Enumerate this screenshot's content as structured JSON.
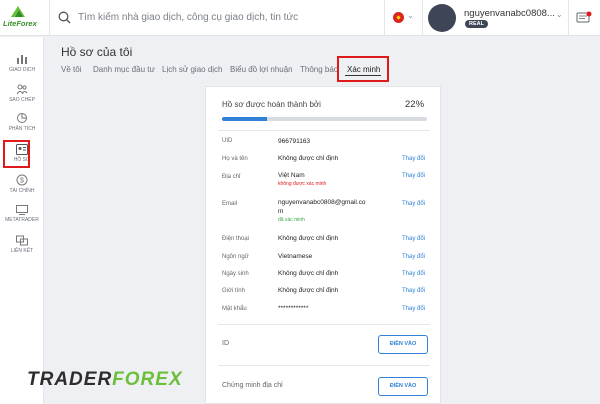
{
  "brand": {
    "logo_text": "LiteForex"
  },
  "search": {
    "placeholder": "Tìm kiếm nhà giao dịch, công cụ giao dịch, tin tức"
  },
  "user": {
    "name": "nguyenvanabc0808...",
    "badge": "REAL"
  },
  "sidebar": {
    "items": [
      {
        "label": "GIAO DỊCH",
        "icon": "trading-icon"
      },
      {
        "label": "SAO CHÉP",
        "icon": "copy-icon"
      },
      {
        "label": "PHÂN TÍCH",
        "icon": "analytics-icon"
      },
      {
        "label": "HỒ SƠ",
        "icon": "profile-icon"
      },
      {
        "label": "TÀI CHÍNH",
        "icon": "dollar-icon"
      },
      {
        "label": "METATRADER",
        "icon": "metatrader-icon"
      },
      {
        "label": "LIÊN KẾT",
        "icon": "link-icon"
      }
    ]
  },
  "page": {
    "title": "Hồ sơ của tôi"
  },
  "tabs": [
    "Về tôi",
    "Danh mục đầu tư",
    "Lịch sử giao dịch",
    "Biểu đồ lợi nhuận",
    "Thông báo",
    "Xác minh"
  ],
  "profile": {
    "completion_label": "Hồ sơ được hoàn thành bởi",
    "completion_percent": "22%",
    "completion_fraction": 0.22,
    "rows": [
      {
        "label": "UID",
        "value": "966791163"
      },
      {
        "label": "Họ và tên",
        "value": "Không được chỉ định",
        "action": "Thay đổi"
      },
      {
        "label": "Địa chỉ",
        "value": "Việt Nam",
        "sub": "không được xác minh",
        "action": "Thay đổi"
      },
      {
        "label": "Email",
        "value": "nguyenvanabc0808@gmail.co",
        "value2": "m",
        "sub": "đã xác minh",
        "action": "Thay đổi"
      },
      {
        "label": "Điện thoại",
        "value": "Không được chỉ định",
        "action": "Thay đổi"
      },
      {
        "label": "Ngôn ngữ",
        "value": "Vietnamese",
        "action": "Thay đổi"
      },
      {
        "label": "Ngày sinh",
        "value": "Không được chỉ định",
        "action": "Thay đổi"
      },
      {
        "label": "Giới tính",
        "value": "Không được chỉ định",
        "action": "Thay đổi"
      },
      {
        "label": "Mật khẩu",
        "value": "************",
        "action": "Thay đổi"
      }
    ],
    "verification": [
      {
        "label": "ID",
        "button": "ĐIỀN VÀO"
      },
      {
        "label": "Chứng minh địa chỉ",
        "button": "ĐIỀN VÀO"
      }
    ]
  },
  "colors": {
    "accent": "#2f80d6",
    "highlight": "#e0191b",
    "unverified": "#e0191b",
    "verified": "#3aa845"
  },
  "watermark": {
    "text_a": "TRADER",
    "text_b": "FOREX"
  }
}
